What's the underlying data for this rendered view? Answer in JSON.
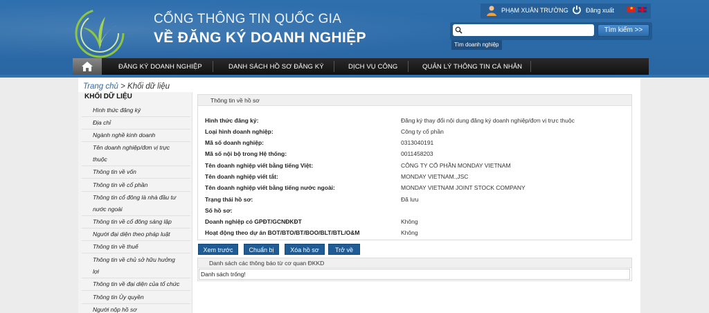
{
  "header": {
    "portal_line1": "CỔNG THÔNG TIN QUỐC GIA",
    "portal_line2": "VỀ ĐĂNG KÝ DOANH NGHIỆP",
    "user_name": "PHẠM XUÂN TRƯỜNG",
    "logout_label": "Đăng xuất",
    "search": {
      "placeholder": "",
      "button_label": "Tìm kiếm >>",
      "hint": "Tìm doanh nghiệp"
    },
    "colors": {
      "header_blue": "#2e6fae",
      "nav_dark": "#1a1a1a",
      "button_blue": "#1f5b94"
    }
  },
  "nav": {
    "items": [
      "ĐĂNG KÝ DOANH NGHIỆP",
      "DANH SÁCH HỒ SƠ ĐĂNG KÝ",
      "DỊCH VỤ CÔNG",
      "QUẢN LÝ THÔNG TIN CÁ NHÂN"
    ]
  },
  "breadcrumb": {
    "home": "Trang chủ",
    "separator": " > ",
    "current": "Khối dữ liệu"
  },
  "sidebar": {
    "title": "KHỐI DỮ LIỆU",
    "items": [
      "Hình thức đăng ký",
      "Địa chỉ",
      "Ngành nghề kinh doanh",
      "Tên doanh nghiệp/đơn vị trực",
      "thuộc",
      "Thông tin về vốn",
      "Thông tin về cổ phần",
      "Thông tin cổ đông là nhà đầu tư",
      "nước ngoài",
      "Thông tin về cổ đông sáng lập",
      "Người đại diện theo pháp luật",
      "Thông tin về thuế",
      "Thông tin về chủ sở hữu hưởng",
      "lợi",
      "Thông tin về đại diện của tổ chức",
      "Thông tin Ủy quyền",
      "Người nộp hồ sơ"
    ]
  },
  "info": {
    "title": "Thông tin về hồ sơ",
    "fields": [
      {
        "label": "Hình thức đăng ký:",
        "value": "Đăng ký thay đổi nội dung đăng ký doanh nghiệp/đơn vị trực thuộc"
      },
      {
        "label": "Loại hình doanh nghiệp:",
        "value": "Công ty cổ phần"
      },
      {
        "label": "Mã số doanh nghiệp:",
        "value": "0313040191"
      },
      {
        "label": "Mã số nội bộ trong Hệ thống:",
        "value": "0011458203"
      },
      {
        "label": "Tên doanh nghiệp viết bằng tiếng Việt:",
        "value": "CÔNG TY CỔ PHẦN MONDAY VIETNAM"
      },
      {
        "label": "Tên doanh nghiệp viết tắt:",
        "value": "MONDAY VIETNAM.,JSC"
      },
      {
        "label": "Tên doanh nghiệp viết bằng tiếng nước ngoài:",
        "value": "MONDAY VIETNAM JOINT STOCK COMPANY"
      },
      {
        "label": "Trạng thái hồ sơ:",
        "value": "Đã lưu"
      },
      {
        "label": "Số hồ sơ:",
        "value": ""
      },
      {
        "label": "Doanh nghiệp có GPĐT/GCNĐKĐT",
        "value": "Không"
      },
      {
        "label": "Hoạt động theo dự án BOT/BTO/BT/BOO/BLT/BTL/O&M",
        "value": "Không"
      }
    ]
  },
  "actions": [
    "Xem trước",
    "Chuẩn bị",
    "Xóa hồ sơ",
    "Trở về"
  ],
  "notices": {
    "title": "Danh sách các thông báo từ cơ quan ĐKKD",
    "empty": "Danh sách trống!"
  }
}
